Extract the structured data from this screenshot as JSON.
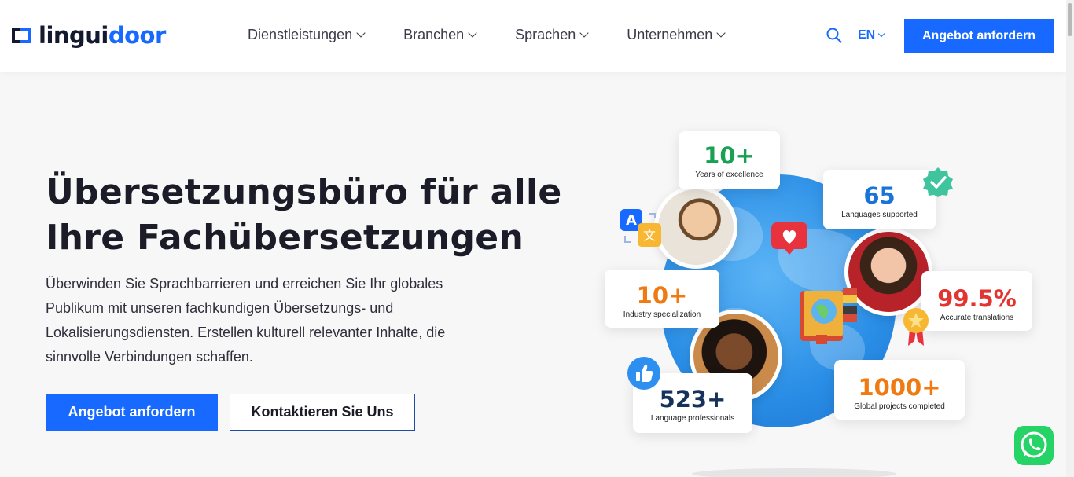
{
  "header": {
    "logo": {
      "part1": "lingui",
      "part2": "door"
    },
    "nav": [
      {
        "label": "Dienstleistungen"
      },
      {
        "label": "Branchen"
      },
      {
        "label": "Sprachen"
      },
      {
        "label": "Unternehmen"
      }
    ],
    "language": "EN",
    "cta": "Angebot anfordern"
  },
  "hero": {
    "title_line1": "Übersetzungsbüro für alle",
    "title_line2": "Ihre Fachübersetzungen",
    "description": "Überwinden Sie Sprachbarrieren und erreichen Sie Ihr globales Publikum mit unseren fachkundigen Übersetzungs- und Lokalisierungsdiensten. Erstellen kulturell relevanter Inhalte, die sinnvolle Verbindungen schaffen.",
    "primary_button": "Angebot anfordern",
    "secondary_button": "Kontaktieren Sie Uns"
  },
  "stats": {
    "years": {
      "value": "10+",
      "label": "Years of excellence"
    },
    "languages": {
      "value": "65",
      "label": "Languages supported"
    },
    "industry": {
      "value": "10+",
      "label": "Industry specialization"
    },
    "accuracy": {
      "value": "99.5%",
      "label": "Accurate translations"
    },
    "professionals": {
      "value": "523+",
      "label": "Language professionals"
    },
    "projects": {
      "value": "1000+",
      "label": "Global projects completed"
    }
  },
  "icons": {
    "search": "search-icon",
    "translate": "translate-icon",
    "heart": "heart-icon",
    "verified": "verified-badge-icon",
    "book": "book-icon",
    "award": "award-ribbon-icon",
    "thumbs_up": "thumbs-up-icon",
    "whatsapp": "whatsapp-icon"
  },
  "colors": {
    "brand_blue": "#1769ff",
    "logo_dark": "#141a2e",
    "whatsapp_green": "#25d366"
  }
}
